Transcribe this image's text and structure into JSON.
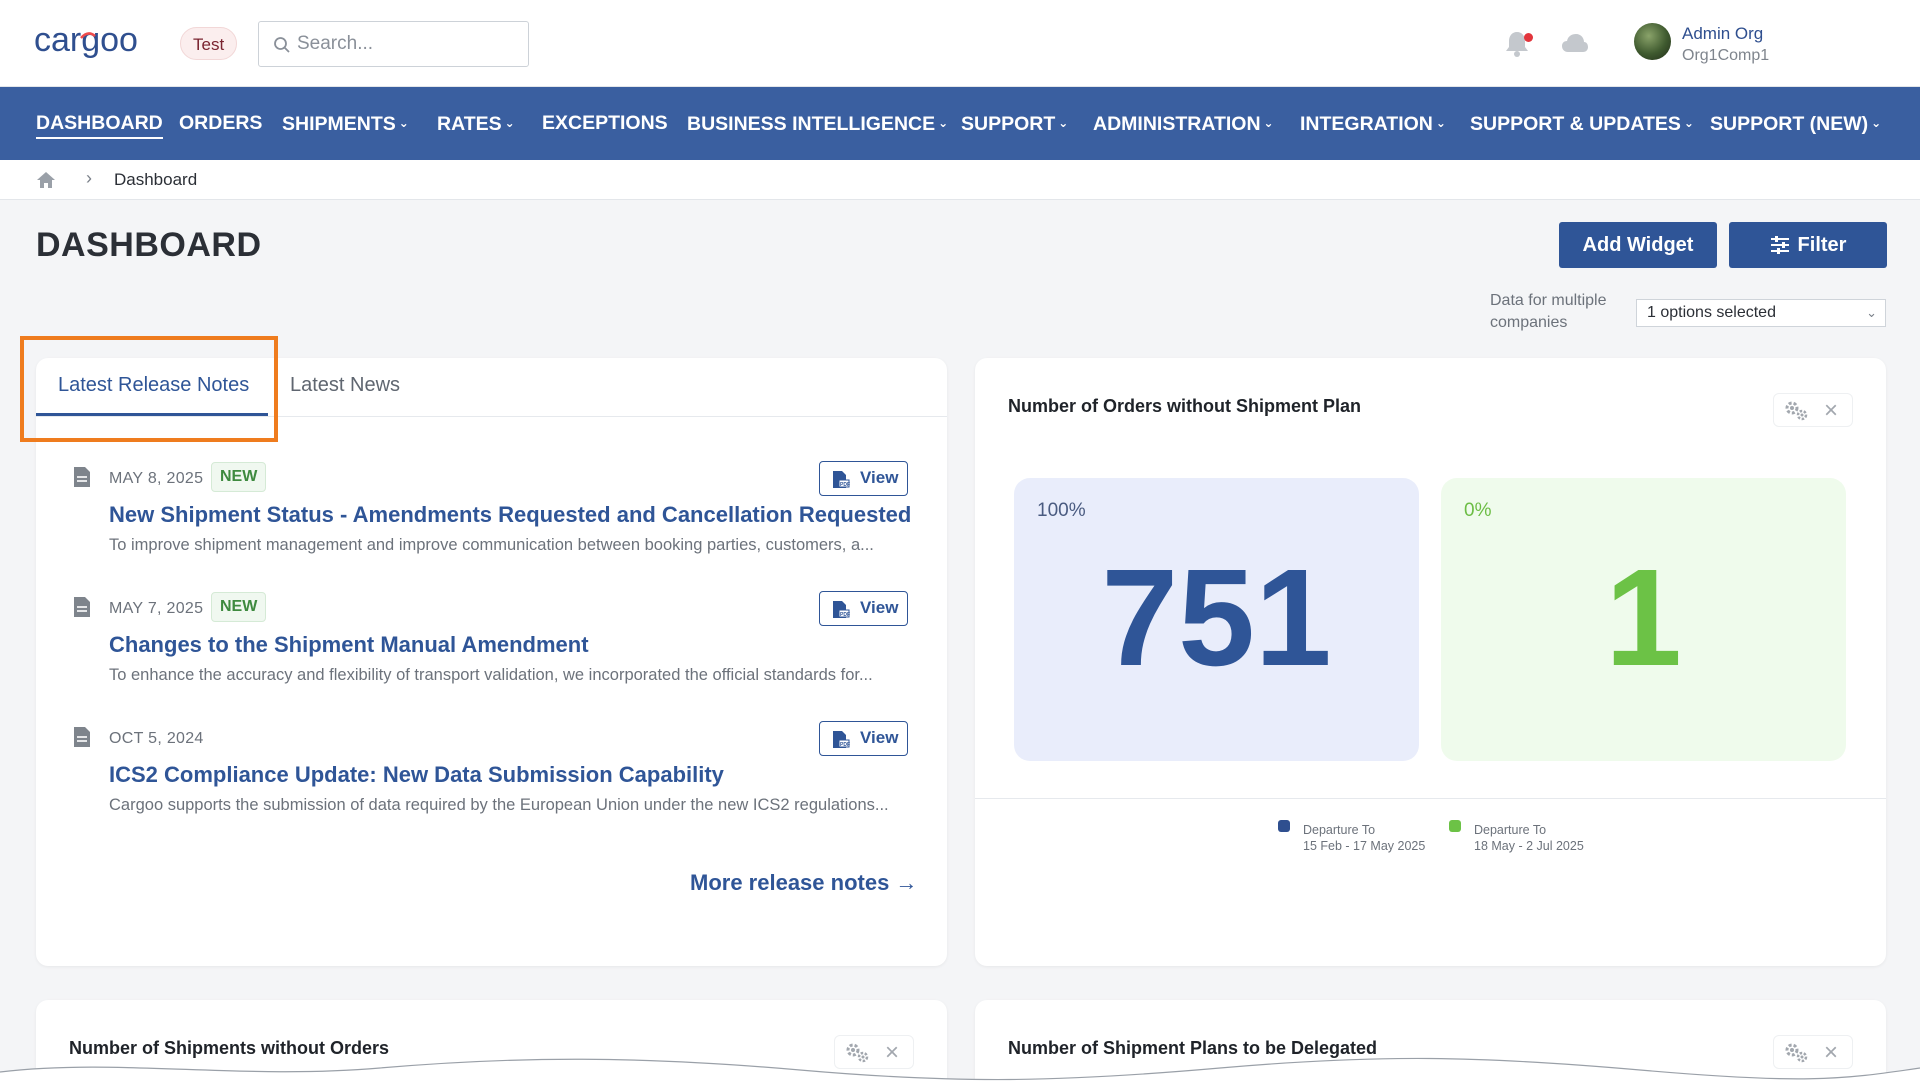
{
  "app": {
    "logo_text": "cargoo",
    "env_badge": "Test",
    "search": {
      "placeholder": "Search..."
    },
    "user": {
      "name": "Admin Org",
      "org": "Org1Comp1"
    }
  },
  "nav": {
    "items": [
      {
        "label": "DASHBOARD",
        "dropdown": false,
        "active": true
      },
      {
        "label": "ORDERS",
        "dropdown": false
      },
      {
        "label": "SHIPMENTS",
        "dropdown": true
      },
      {
        "label": "RATES",
        "dropdown": true
      },
      {
        "label": "EXCEPTIONS",
        "dropdown": false
      },
      {
        "label": "BUSINESS INTELLIGENCE",
        "dropdown": true
      },
      {
        "label": "SUPPORT",
        "dropdown": true
      },
      {
        "label": "ADMINISTRATION",
        "dropdown": true
      },
      {
        "label": "INTEGRATION",
        "dropdown": true
      },
      {
        "label": "SUPPORT & UPDATES",
        "dropdown": true
      },
      {
        "label": "SUPPORT (NEW)",
        "dropdown": true
      }
    ]
  },
  "breadcrumb": {
    "current": "Dashboard"
  },
  "page": {
    "title": "DASHBOARD",
    "add_widget": "Add Widget",
    "filter": "Filter",
    "multi_company_label": "Data for multiple companies",
    "multi_company_value": "1 options selected"
  },
  "release_notes": {
    "tabs": [
      "Latest Release Notes",
      "Latest News"
    ],
    "items": [
      {
        "date": "MAY 8, 2025",
        "badge": "NEW",
        "view": "View",
        "title": "New Shipment Status - Amendments Requested and Cancellation Requested",
        "desc": "To improve shipment management and improve communication between booking parties, customers, a..."
      },
      {
        "date": "MAY 7, 2025",
        "badge": "NEW",
        "view": "View",
        "title": "Changes to the Shipment Manual Amendment",
        "desc": "To enhance the accuracy and flexibility of transport validation, we incorporated the official standards for..."
      },
      {
        "date": "OCT 5, 2024",
        "badge": "",
        "view": "View",
        "title": "ICS2 Compliance Update: New Data Submission Capability",
        "desc": "Cargoo supports the submission of data required by the European Union under the new ICS2 regulations..."
      }
    ],
    "more_link": "More release notes →"
  },
  "kpi_widget": {
    "title": "Number of Orders without Shipment Plan",
    "left": {
      "pct": "100%",
      "value": "751"
    },
    "right": {
      "pct": "0%",
      "value": "1"
    },
    "legend": [
      {
        "line1": "Departure To",
        "line2": "15 Feb - 17 May 2025",
        "color": "#2f4f8f"
      },
      {
        "line1": "Departure To",
        "line2": "18 May - 2 Jul 2025",
        "color": "#6cc246"
      }
    ]
  },
  "bottom_widgets": {
    "left_title": "Number of Shipments without Orders",
    "right_title": "Number of Shipment Plans to be Delegated"
  },
  "colors": {
    "brand": "#3a5fa0",
    "accent": "#2f5597",
    "highlight": "#ef7c1e",
    "green": "#6cc246"
  }
}
